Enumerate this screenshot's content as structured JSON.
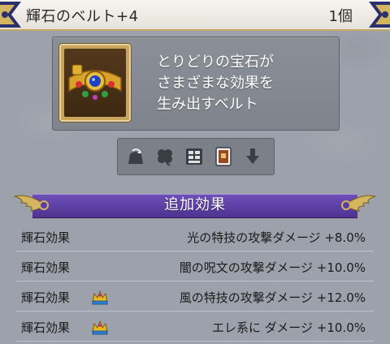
{
  "header": {
    "item_name": "輝石のベルト+4",
    "count": "1個"
  },
  "item": {
    "icon": "jeweled-belt-icon",
    "description_lines": [
      "とりどりの宝石が",
      "さまざまな効果を",
      "生み出すベルト"
    ]
  },
  "category_icons": [
    {
      "name": "bag-refresh-icon"
    },
    {
      "name": "clover-icon"
    },
    {
      "name": "storage-chest-icon"
    },
    {
      "name": "book-icon"
    },
    {
      "name": "down-arrow-icon"
    }
  ],
  "section": {
    "title": "追加効果"
  },
  "effects": [
    {
      "label": "輝石効果",
      "crown": false,
      "value": "光の特技の攻撃ダメージ +8.0%"
    },
    {
      "label": "輝石効果",
      "crown": false,
      "value": "闇の呪文の攻撃ダメージ +10.0%"
    },
    {
      "label": "輝石効果",
      "crown": true,
      "value": "風の特技の攻撃ダメージ +12.0%"
    },
    {
      "label": "輝石効果",
      "crown": true,
      "value": "エレ系に ダメージ +10.0%"
    }
  ],
  "colors": {
    "background": "#9da1ab",
    "section_purple": "#5b3fa3",
    "frame_gold": "#c8a45c"
  }
}
